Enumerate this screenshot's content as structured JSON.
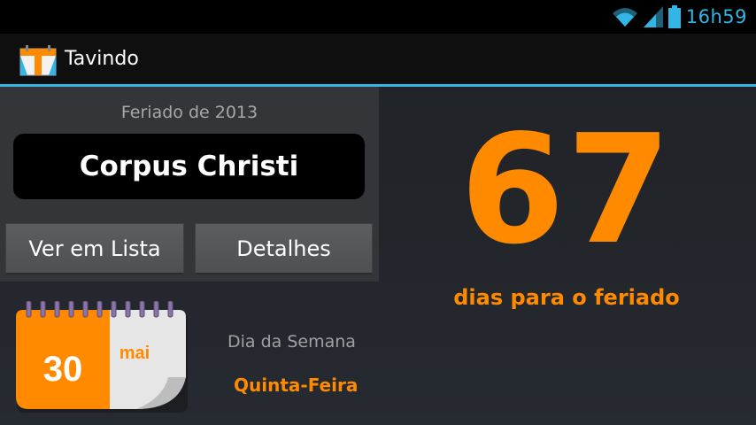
{
  "status_bar": {
    "time": "16h59",
    "icons": [
      "wifi-icon",
      "signal-icon",
      "battery-icon"
    ],
    "accent": "#33b5e5"
  },
  "action_bar": {
    "app_title": "Tavindo",
    "logo_icon": "calendar-logo-icon"
  },
  "holiday": {
    "year_label": "Feriado de 2013",
    "name": "Corpus Christi"
  },
  "buttons": {
    "list_label": "Ver em Lista",
    "details_label": "Detalhes"
  },
  "countdown": {
    "days": "67",
    "caption": "dias para o feriado",
    "color": "#ff8a00"
  },
  "date": {
    "day": "30",
    "month": "mai",
    "weekday_label": "Dia da Semana",
    "weekday": "Quinta-Feira"
  }
}
